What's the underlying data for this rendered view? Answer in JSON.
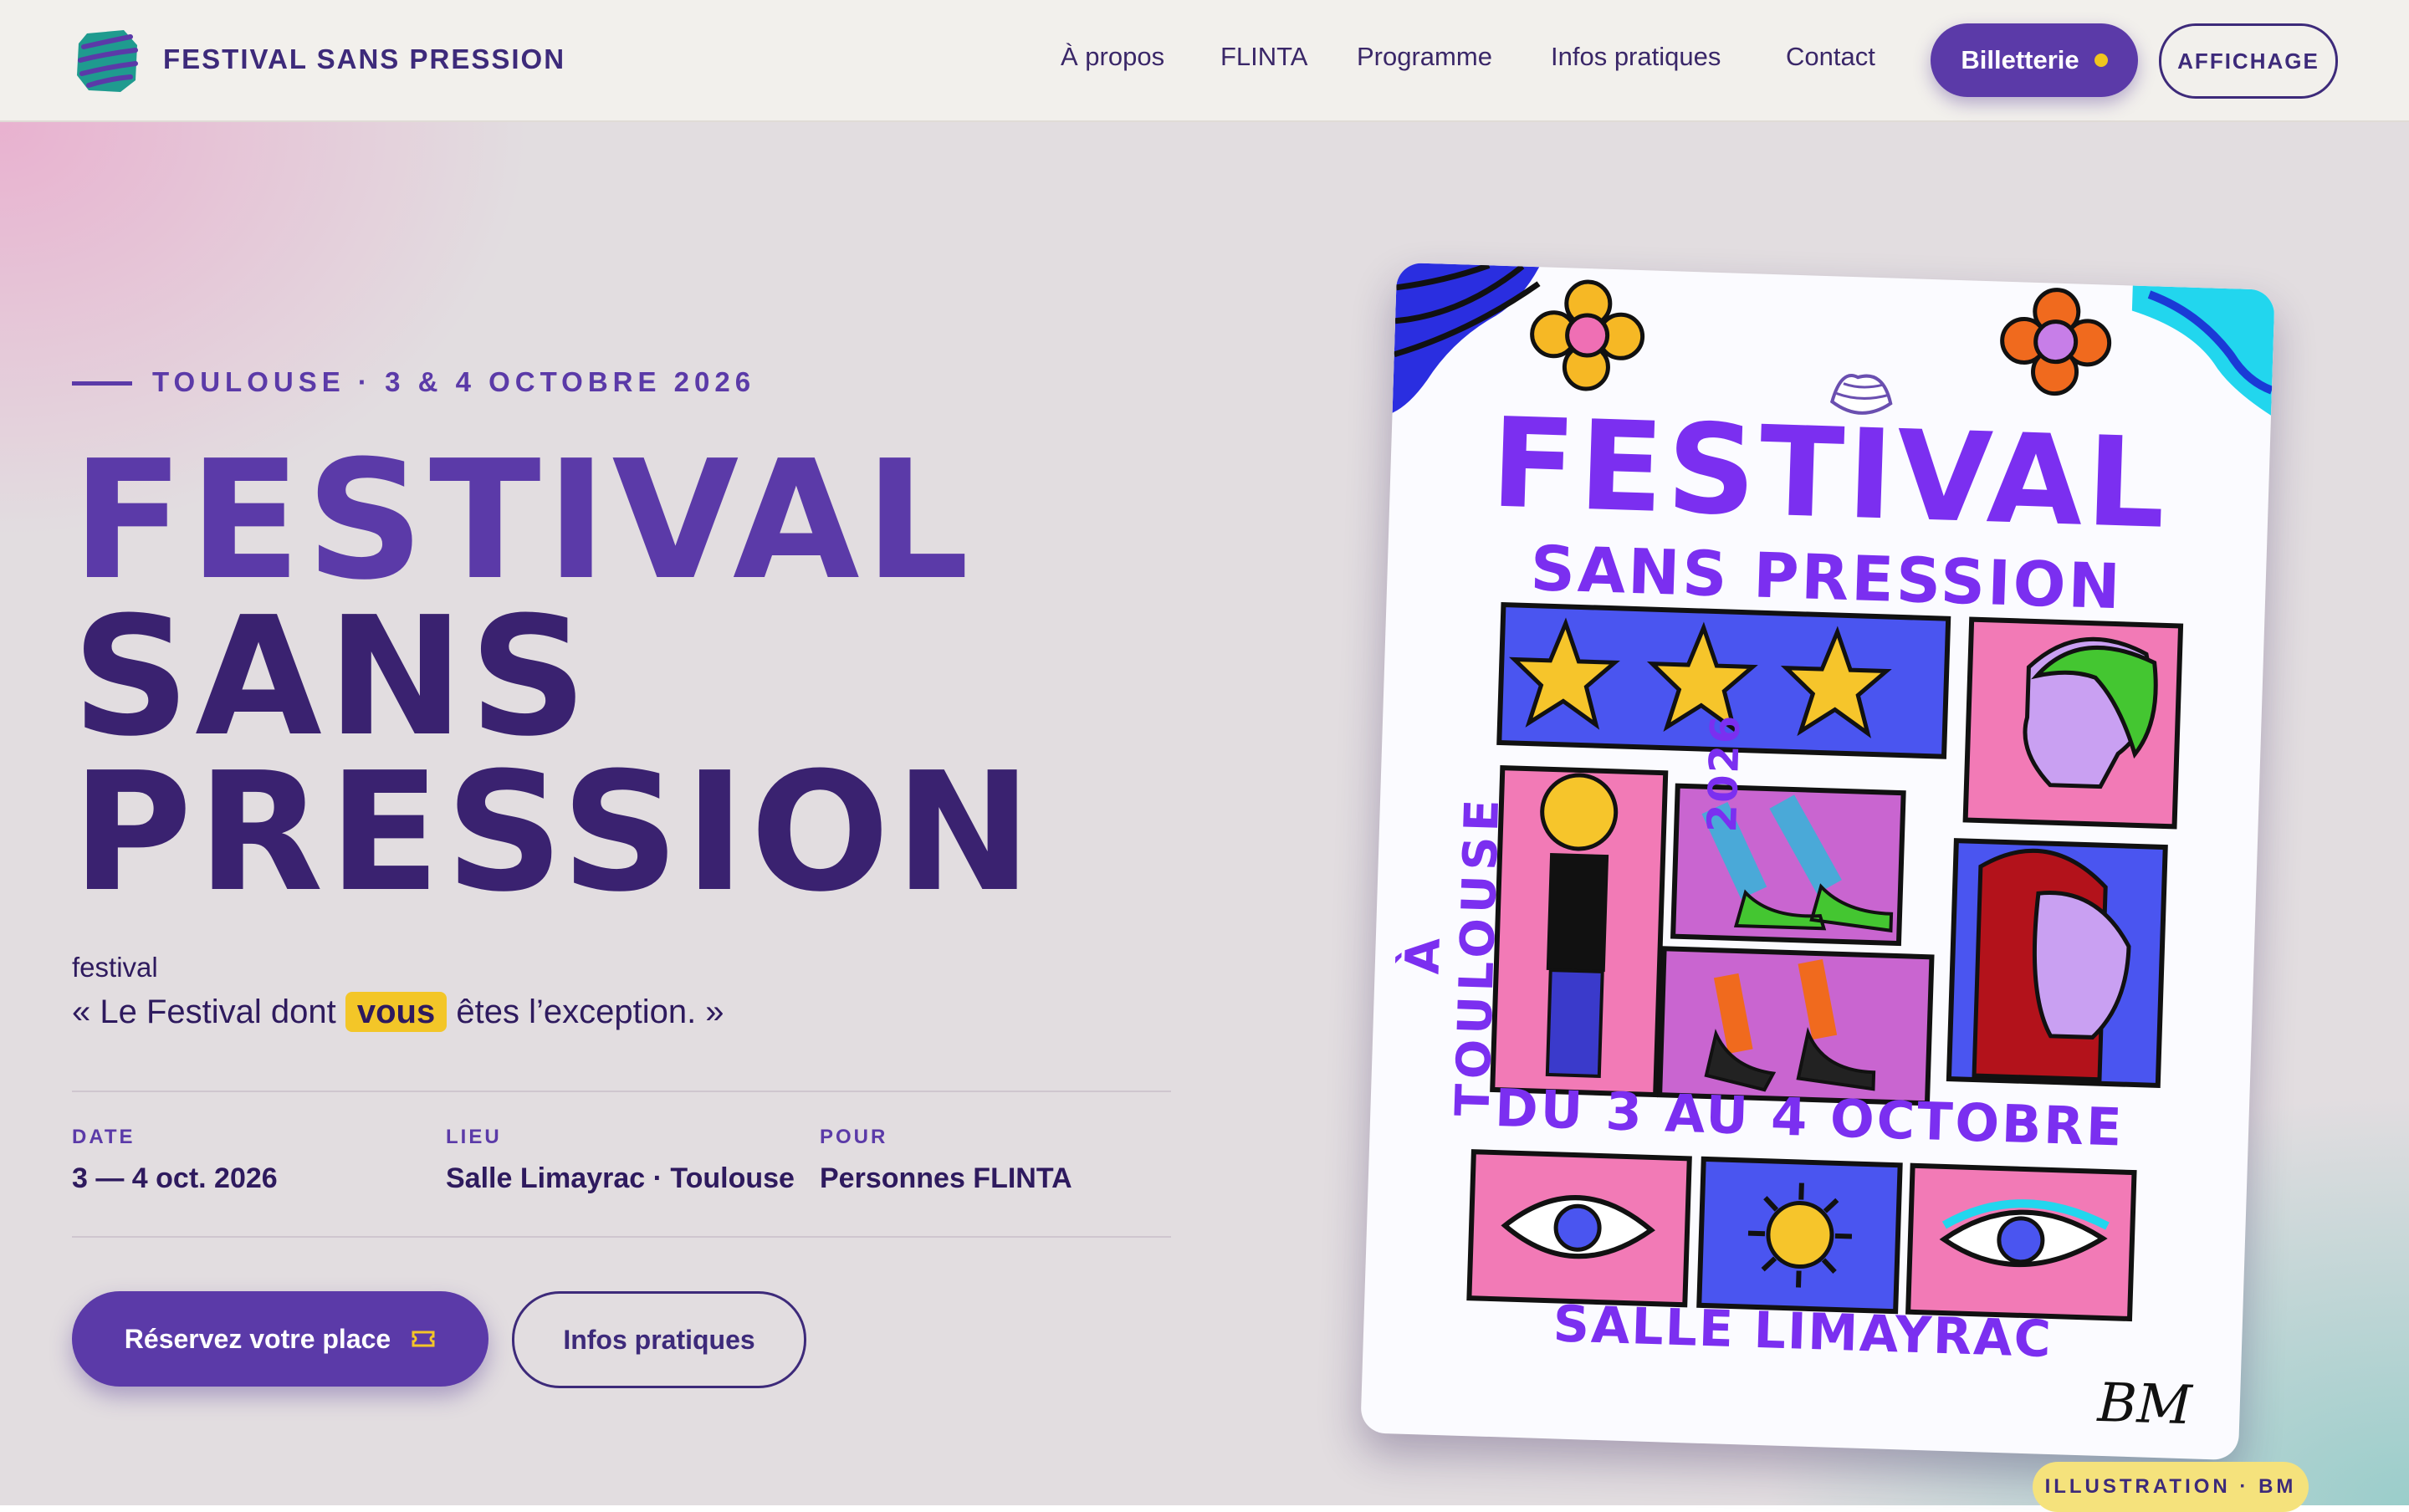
{
  "header": {
    "brand": "FESTIVAL SANS PRESSION",
    "nav": [
      "À propos",
      "FLINTA",
      "Programme",
      "Infos pratiques",
      "Contact"
    ],
    "ticket_label": "Billetterie",
    "affichage_label": "AFFICHAGE"
  },
  "hero": {
    "eyebrow": "TOULOUSE · 3 & 4 OCTOBRE 2026",
    "title_line1": "FESTIVAL",
    "title_line2": "SANS",
    "title_line3": "PRESSION",
    "tag": "festival",
    "quote_before": "« Le Festival dont",
    "quote_highlight": "vous",
    "quote_after": "êtes l’exception. »",
    "meta": [
      {
        "label": "DATE",
        "value": "3 — 4 oct. 2026"
      },
      {
        "label": "LIEU",
        "value": "Salle Limayrac · Toulouse"
      },
      {
        "label": "POUR",
        "value": "Personnes FLINTA"
      }
    ],
    "primary_button": "Réservez votre place",
    "secondary_button": "Infos pratiques"
  },
  "poster": {
    "title": "FESTIVAL",
    "subtitle": "SANS PRESSION",
    "side_text": "À TOULOUSE",
    "year": "2026",
    "dates": "DU 3 AU 4 OCTOBRE",
    "venue": "SALLE LIMAYRAC",
    "signature": "BM"
  },
  "credit": "ILLUSTRATION · BM",
  "colors": {
    "accent": "#5b3aa8",
    "dark_purple": "#3a2270",
    "highlight": "#f3c628",
    "poster_purple": "#7b2ff0"
  },
  "icons": [
    "logo-mark-icon",
    "ticket-dot-icon",
    "ticket-icon"
  ]
}
